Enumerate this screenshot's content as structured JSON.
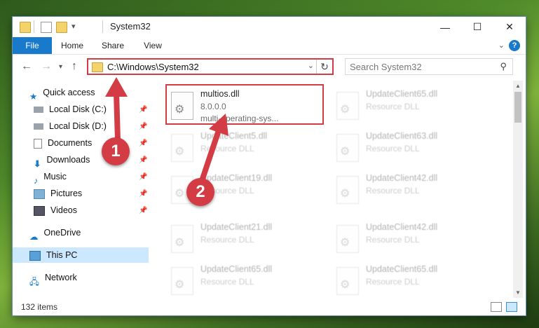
{
  "window": {
    "title": "System32",
    "minimize": "—",
    "maximize": "☐",
    "close": "✕"
  },
  "ribbon": {
    "tabs": [
      "File",
      "Home",
      "Share",
      "View"
    ],
    "help": "?"
  },
  "address": {
    "path": "C:\\Windows\\System32",
    "search_placeholder": "Search System32"
  },
  "sidebar": {
    "items": [
      {
        "label": "Quick access",
        "icon": "star-icon"
      },
      {
        "label": "Local Disk (C:)",
        "icon": "drive-icon"
      },
      {
        "label": "Local Disk (D:)",
        "icon": "drive-icon"
      },
      {
        "label": "Documents",
        "icon": "documents-icon"
      },
      {
        "label": "Downloads",
        "icon": "downloads-icon"
      },
      {
        "label": "Music",
        "icon": "music-icon"
      },
      {
        "label": "Pictures",
        "icon": "pictures-icon"
      },
      {
        "label": "Videos",
        "icon": "videos-icon"
      },
      {
        "label": "OneDrive",
        "icon": "onedrive-icon"
      },
      {
        "label": "This PC",
        "icon": "computer-icon"
      },
      {
        "label": "Network",
        "icon": "network-icon"
      }
    ]
  },
  "files": {
    "left": [
      {
        "name": "multios.dll",
        "line1": "8.0.0.0",
        "line2": "multi-operating-sys..."
      },
      {
        "name": "UpdateClient5.dll",
        "line1": "Resource DLL",
        "line2": ""
      },
      {
        "name": "UpdateClient19.dll",
        "line1": "Resource DLL",
        "line2": ""
      },
      {
        "name": "UpdateClient21.dll",
        "line1": "Resource DLL",
        "line2": ""
      },
      {
        "name": "UpdateClient65.dll",
        "line1": "Resource DLL",
        "line2": ""
      }
    ],
    "right": [
      {
        "name": "UpdateClient65.dll",
        "line1": "Resource DLL"
      },
      {
        "name": "UpdateClient63.dll",
        "line1": "Resource DLL"
      },
      {
        "name": "UpdateClient42.dll",
        "line1": "Resource DLL"
      },
      {
        "name": "UpdateClient42.dll",
        "line1": "Resource DLL"
      },
      {
        "name": "UpdateClient65.dll",
        "line1": "Resource DLL"
      }
    ]
  },
  "status": {
    "count": "132 items"
  },
  "callouts": [
    "1",
    "2"
  ],
  "colors": {
    "accent": "#1979ca",
    "highlight": "#d33b45"
  }
}
